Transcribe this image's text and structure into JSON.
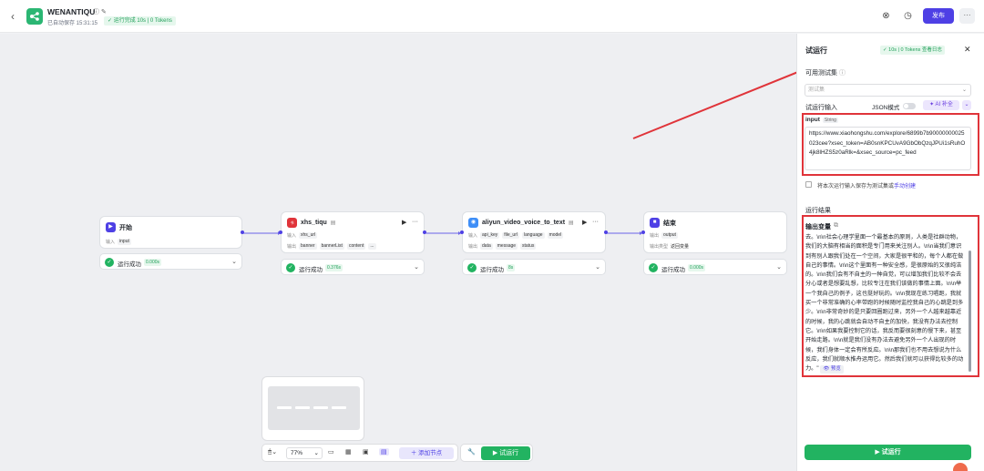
{
  "header": {
    "back_icon": "chevron-left-icon",
    "app_title": "WENANTIQU",
    "save_status": "已自动保存 15:31:15",
    "run_status": "运行完成 10s | 0 Tokens",
    "publish_label": "发布",
    "more_label": "···"
  },
  "nodes": [
    {
      "title": "开始",
      "row1_label": "输入",
      "row1_chips": [
        "input"
      ],
      "status": "运行成功",
      "duration": "0.000s",
      "icon_color": "#4e40e5"
    },
    {
      "title": "xhs_tiqu",
      "row1_label": "输入",
      "row1_chips": [
        "xhs_url"
      ],
      "row2_label": "输出",
      "row2_chips": [
        "banner",
        "bannerList",
        "content",
        "..."
      ],
      "status": "运行成功",
      "duration": "0.376s",
      "icon_color": "#e0343a"
    },
    {
      "title": "aliyun_video_voice_to_text",
      "row1_label": "输入",
      "row1_chips": [
        "api_key",
        "file_url",
        "language",
        "model"
      ],
      "row2_label": "输出",
      "row2_chips": [
        "data",
        "message",
        "status"
      ],
      "status": "运行成功",
      "duration": "8s",
      "icon_color": "#3e8ef7"
    },
    {
      "title": "结束",
      "row1_label": "输出",
      "row1_chips": [
        "output"
      ],
      "row2_label": "输出类型",
      "row2_value": "返回变量",
      "status": "运行成功",
      "duration": "0.000s",
      "icon_color": "#4e40e5"
    }
  ],
  "toolbar": {
    "zoom": "77%",
    "add_node": "添加节点",
    "run": "试运行"
  },
  "panel": {
    "title": "试运行",
    "badge": "10s | 0 Tokens  查看日志",
    "close": "✕",
    "testset_label": "可用测试集",
    "testset_placeholder": "测试集",
    "input_section": "试运行输入",
    "json_mode": "JSON模式",
    "ai_fill": "AI 补全",
    "input_name": "input",
    "input_type": "String",
    "input_value": "https://www.xiaohongshu.com/explore/6899b7b90000000025023cee?xsec_token=AB0snKPCUvA9GbObQzqJPUi1sRuhO4jk8lHZS5z0aRlk=&xsec_source=pc_feed",
    "save_checkbox": "将本次运行输入保存为测试集或",
    "save_link": "手动创建",
    "result_section": "运行结果",
    "output_var": "输出变量",
    "output_text": "去。\\n\\n社会心理学里面一个最基本的原则，人类是社群动物，我们的大脑有相当的面积是专门用来关注别人。\\n\\n当我们意识到有别人跟我们处在一个空间，大家是很平和的，每个人都在做自己的事情。\\n\\n这个里面有一种安全感，是很原始的又很纯洁的。\\n\\n我们会有不自主的一种自觉，可以增加我们比较不会去分心或者是想要乱想，比较专注在我们该做的事情上面。\\n\\n举一个我自己的例子，这也挺好玩的。\\n\\n我现在练习唱跑，我就买一个非常准确的心率带跑的时候随时监控我自己的心跳是到多少。\\n\\n非常奇妙的是只要回圈跑过来，另外一个人越来越靠近的时候，我的心跳就会自动不自主的加快，我没有办法去控制它。\\n\\n如果我要控制它的话，我反而要很刻意的慢下来，甚至开始走路。\\n\\n就是我们没有办法去避免另外一个人出现的时候，我们身体一定会有所反应。\\n\\n那我们也不用去想说为什么反应，我们就顺水推舟运用它。然后我们就可以获得比较多的动力。\"",
    "preview": "预览",
    "run_button": "试运行"
  }
}
